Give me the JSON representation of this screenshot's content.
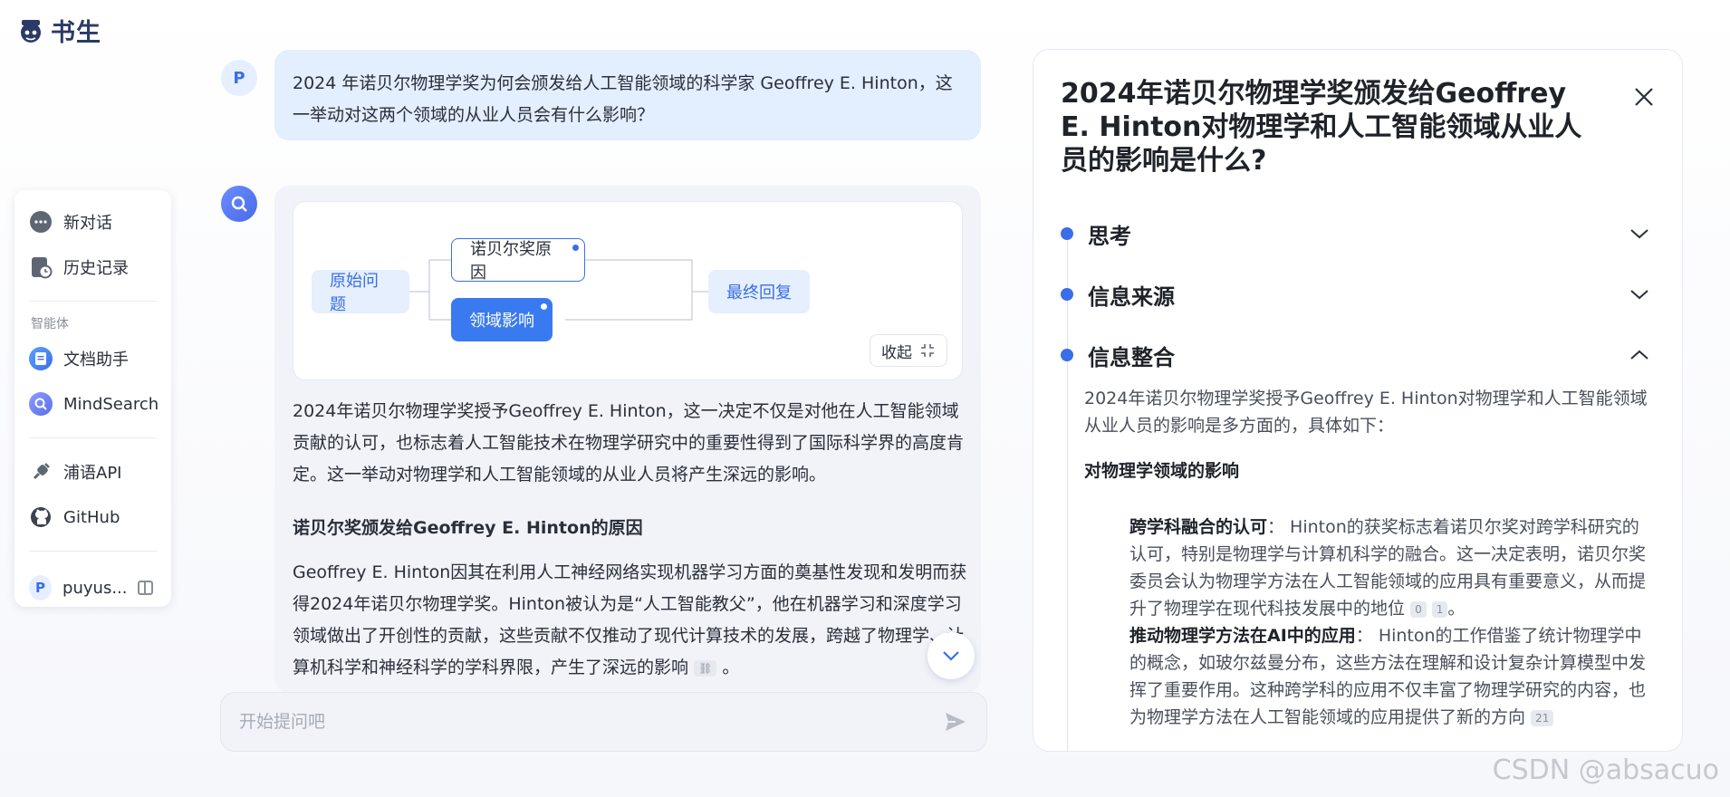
{
  "app": {
    "logo_text": "书生"
  },
  "sidebar": {
    "new_chat": "新对话",
    "history": "历史记录",
    "agents_section": "智能体",
    "doc_assistant": "文档助手",
    "mindsearch": "MindSearch",
    "api": "浦语API",
    "github": "GitHub",
    "user_initial": "P",
    "user_name": "puyus..."
  },
  "chat": {
    "user_initial": "P",
    "user_question": "2024 年诺贝尔物理学奖为何会颁发给人工智能领域的科学家 Geoffrey E. Hinton，这一举动对这两个领域的从业人员会有什么影响？",
    "mindmap": {
      "origin": "原始问题",
      "node_reason": "诺贝尔奖原因",
      "node_impact": "领域影响",
      "final": "最终回复",
      "collapse_label": "收起"
    },
    "answer_p1": "2024年诺贝尔物理学奖授予Geoffrey E. Hinton，这一决定不仅是对他在人工智能领域贡献的认可，也标志着人工智能技术在物理学研究中的重要性得到了国际科学界的高度肯定。这一举动对物理学和人工智能领域的从业人员将产生深远的影响。",
    "answer_h1": "诺贝尔奖颁发给Geoffrey E. Hinton的原因",
    "answer_p2": "Geoffrey E. Hinton因其在利用人工神经网络实现机器学习方面的奠基性发现和发明而获得2024年诺贝尔物理学奖。Hinton被认为是“人工智能教父”，他在机器学习和深度学习领域做出了开创性的贡献，这些贡献不仅推动了现代计算技术的发展，跨越了物理学、计算机科学和神经科学的学科界限，产生了深远的影响",
    "answer_p2_end": "。",
    "input_placeholder": "开始提问吧"
  },
  "right_panel": {
    "title": "2024年诺贝尔物理学奖颁发给Geoffrey E. Hinton对物理学和人工智能领域从业人员的影响是什么?",
    "steps": [
      "思考",
      "信息来源",
      "信息整合"
    ],
    "intro": "2024年诺贝尔物理学奖授予Geoffrey E. Hinton对物理学和人工智能领域从业人员的影响是多方面的，具体如下：",
    "section_title": "对物理学领域的影响",
    "bullet1_label": "跨学科融合的认可",
    "bullet1_text": "： Hinton的获奖标志着诺贝尔奖对跨学科研究的认可，特别是物理学与计算机科学的融合。这一决定表明，诺贝尔奖委员会认为物理学方法在人工智能领域的应用具有重要意义，从而提升了物理学在现代科技发展中的地位",
    "bullet1_cites": [
      "0",
      "1"
    ],
    "bullet1_end": "。",
    "bullet2_label": "推动物理学方法在AI中的应用",
    "bullet2_text": "： Hinton的工作借鉴了统计物理学中的概念，如玻尔兹曼分布，这些方法在理解和设计复杂计算模型中发挥了重要作用。这种跨学科的应用不仅丰富了物理学研究的内容，也为物理学方法在人工智能领域的应用提供了新的方向",
    "bullet2_cite": "21"
  },
  "watermark": "CSDN @absacuo",
  "colors": {
    "accent": "#3a6ee8",
    "bubble": "#e3eefe",
    "panel": "#f1f3f9"
  }
}
